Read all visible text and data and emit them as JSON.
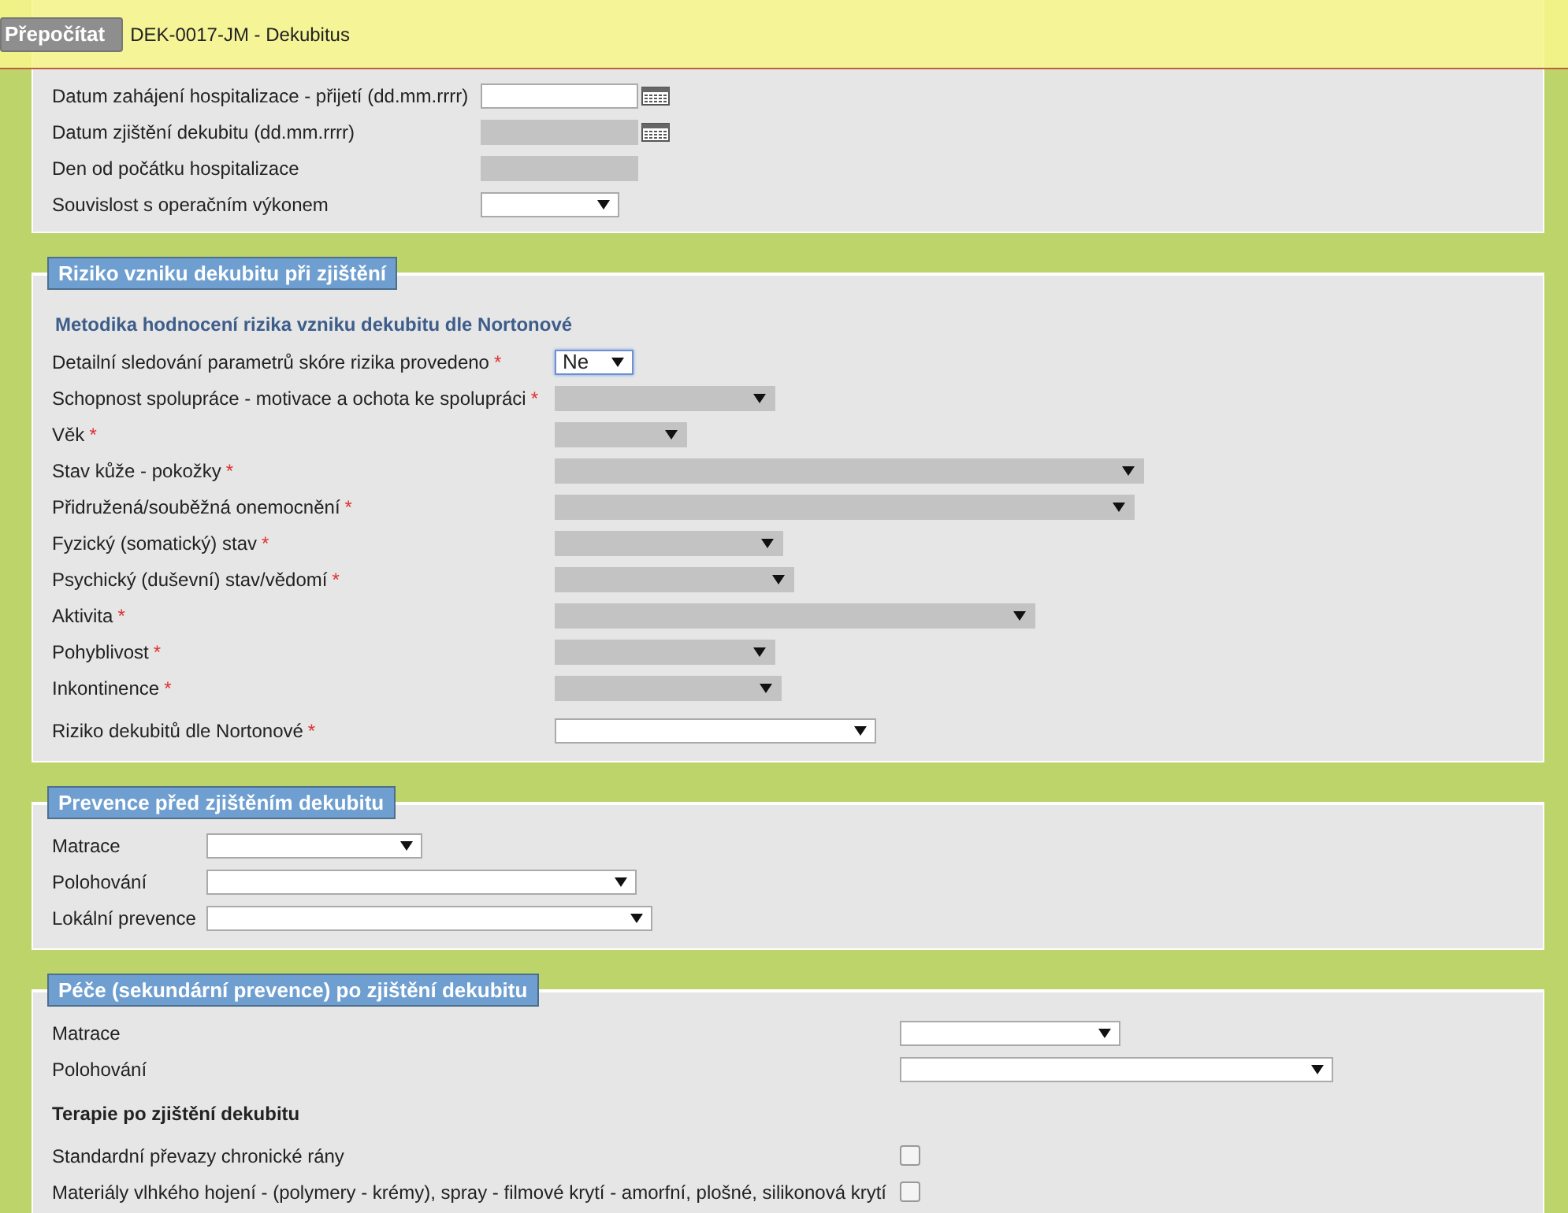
{
  "header": {
    "button": "Přepočítat",
    "title": "DEK-0017-JM - Dekubitus"
  },
  "sections": [
    {
      "fields": [
        {
          "kind": "date",
          "label": "Datum zahájení hospitalizace - přijetí (dd.mm.rrrr)",
          "disabled": false
        },
        {
          "kind": "date",
          "label": "Datum zjištění dekubitu (dd.mm.rrrr)",
          "disabled": true
        },
        {
          "kind": "text",
          "label": "Den od počátku hospitalizace",
          "disabled": true
        },
        {
          "kind": "select",
          "label": "Souvislost s operačním výkonem",
          "disabled": false
        }
      ]
    },
    {
      "title": "Riziko vzniku dekubitu při zjištění",
      "fields": [
        {
          "kind": "subheading",
          "label": "Metodika hodnocení rizika vzniku dekubitu dle Nortonové"
        },
        {
          "kind": "select",
          "label": "Detailní sledování parametrů skóre rizika provedeno",
          "required_mark": "*",
          "disabled": false,
          "focused": true,
          "value": "Ne"
        },
        {
          "kind": "select",
          "label": "Schopnost spolupráce - motivace a ochota ke spolupráci",
          "required_mark": "*",
          "disabled": true
        },
        {
          "kind": "select",
          "label": "Věk",
          "required_mark": "*",
          "disabled": true
        },
        {
          "kind": "select",
          "label": "Stav kůže - pokožky",
          "required_mark": "*",
          "disabled": true
        },
        {
          "kind": "select",
          "label": "Přidružená/souběžná onemocnění",
          "required_mark": "*",
          "disabled": true
        },
        {
          "kind": "select",
          "label": "Fyzický (somatický) stav",
          "required_mark": "*",
          "disabled": true
        },
        {
          "kind": "select",
          "label": "Psychický (duševní) stav/vědomí",
          "required_mark": "*",
          "disabled": true
        },
        {
          "kind": "select",
          "label": "Aktivita",
          "required_mark": "*",
          "disabled": true
        },
        {
          "kind": "select",
          "label": "Pohyblivost",
          "required_mark": "*",
          "disabled": true
        },
        {
          "kind": "select",
          "label": "Inkontinence",
          "required_mark": "*",
          "disabled": true
        },
        {
          "kind": "select",
          "label": "Riziko dekubitů dle Nortonové",
          "required_mark": "*",
          "disabled": false
        }
      ]
    },
    {
      "title": "Prevence před zjištěním dekubitu",
      "fields": [
        {
          "kind": "select",
          "label": "Matrace",
          "disabled": false
        },
        {
          "kind": "select",
          "label": "Polohování",
          "disabled": false
        },
        {
          "kind": "select",
          "label": "Lokální prevence",
          "disabled": false
        }
      ]
    },
    {
      "title": "Péče (sekundární prevence) po zjištění dekubitu",
      "fields": [
        {
          "kind": "select",
          "label": "Matrace",
          "disabled": false
        },
        {
          "kind": "select",
          "label": "Polohování",
          "disabled": false
        },
        {
          "kind": "subheading",
          "label": "Terapie po zjištění dekubitu"
        },
        {
          "kind": "checkbox",
          "label": "Standardní převazy chronické rány",
          "checked": false
        },
        {
          "kind": "checkbox",
          "label": "Materiály vlhkého hojení - (polymery - krémy), spray - filmové krytí - amorfní, plošné, silikonová krytí",
          "checked": false
        }
      ]
    }
  ]
}
